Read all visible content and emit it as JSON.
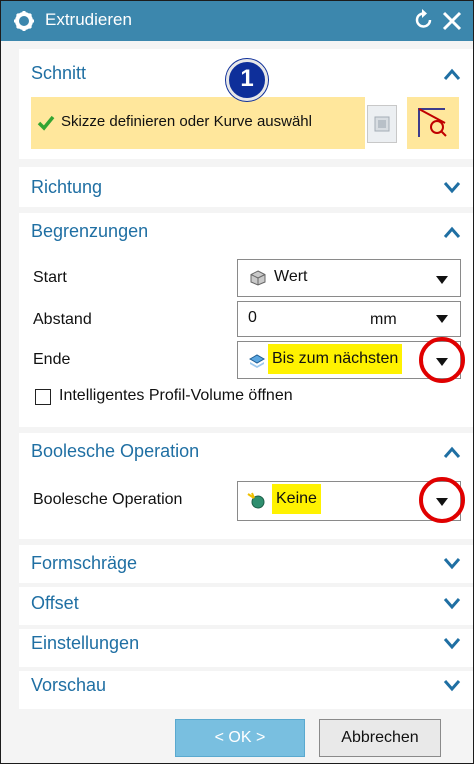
{
  "window": {
    "title": "Extrudieren"
  },
  "marker": {
    "number": "1"
  },
  "sections": {
    "schnitt": {
      "title": "Schnitt",
      "selection_text": "Skizze definieren oder Kurve auswähl"
    },
    "richtung": {
      "title": "Richtung"
    },
    "begrenzungen": {
      "title": "Begrenzungen",
      "start_label": "Start",
      "start_value": "Wert",
      "abstand_label": "Abstand",
      "abstand_value": "0",
      "abstand_unit": "mm",
      "ende_label": "Ende",
      "ende_value": "Bis zum nächsten",
      "checkbox_label": "Intelligentes Profil-Volume öffnen"
    },
    "boolesche": {
      "title": "Boolesche Operation",
      "label": "Boolesche Operation",
      "value": "Keine"
    },
    "formschraege": {
      "title": "Formschräge"
    },
    "offset": {
      "title": "Offset"
    },
    "einstellungen": {
      "title": "Einstellungen"
    },
    "vorschau": {
      "title": "Vorschau"
    }
  },
  "buttons": {
    "ok": "< OK >",
    "cancel": "Abbrechen"
  },
  "colors": {
    "titlebar": "#3c87ad",
    "section_title": "#1f6fa3",
    "highlight": "#fff200",
    "annotation_circle": "#e00000"
  }
}
